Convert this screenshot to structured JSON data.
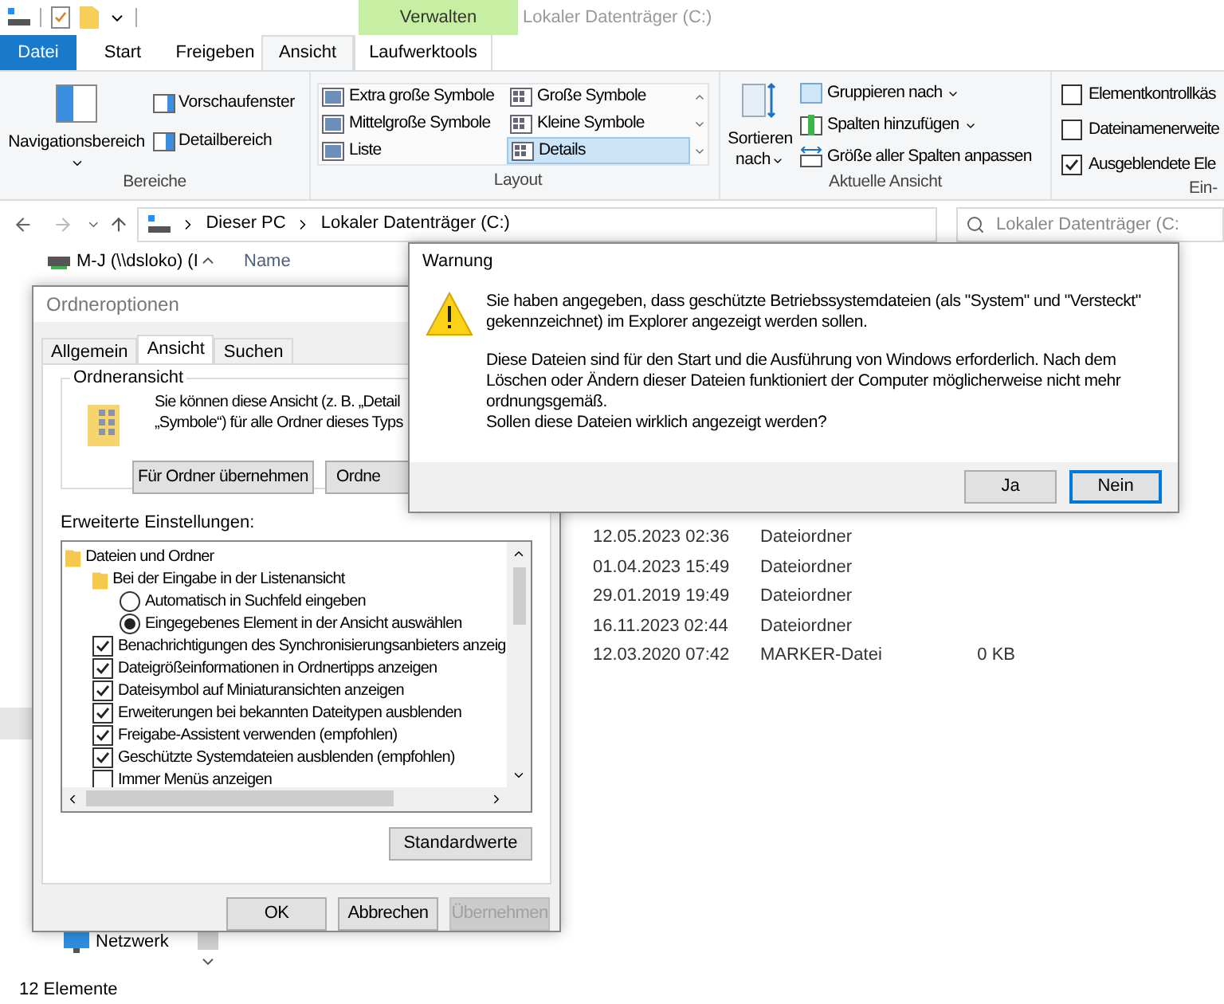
{
  "explorer": {
    "context_group": "Verwalten",
    "title": "Lokaler Datenträger (C:)",
    "tabs": [
      {
        "label": "Datei",
        "kind": "file",
        "selected": false
      },
      {
        "label": "Start",
        "kind": "tab",
        "selected": false
      },
      {
        "label": "Freigeben",
        "kind": "tab",
        "selected": false
      },
      {
        "label": "Ansicht",
        "kind": "tab",
        "selected": true
      },
      {
        "label": "Laufwerktools",
        "kind": "context",
        "selected": false
      }
    ],
    "panes_group": {
      "label": "Bereiche",
      "navigation": "Navigationsbereich",
      "preview": "Vorschaufenster",
      "details": "Detailbereich"
    },
    "layout_group": {
      "label": "Layout",
      "options": [
        {
          "label": "Extra große Symbole",
          "selected": false
        },
        {
          "label": "Große Symbole",
          "selected": false
        },
        {
          "label": "Mittelgroße Symbole",
          "selected": false
        },
        {
          "label": "Kleine Symbole",
          "selected": false
        },
        {
          "label": "Liste",
          "selected": false
        },
        {
          "label": "Details",
          "selected": true
        }
      ]
    },
    "view_group": {
      "label": "Aktuelle Ansicht",
      "sort_lines": [
        "Sortieren",
        "nach"
      ],
      "group_by": "Gruppieren nach",
      "add_columns": "Spalten hinzufügen",
      "fit_columns": "Größe aller Spalten anpassen"
    },
    "show_group": {
      "label": "Ein-",
      "options": [
        {
          "label": "Elementkontrollkäs",
          "checked": false
        },
        {
          "label": "Dateinamenerweite",
          "checked": false
        },
        {
          "label": "Ausgeblendete Ele",
          "checked": true
        }
      ]
    },
    "address": {
      "path": [
        "Dieser PC",
        "Lokaler Datenträger (C:)"
      ]
    },
    "search": {
      "placeholder": "Lokaler Datenträger (C:"
    },
    "nav_pane": {
      "items": [
        {
          "label": "M-J (\\\\dsloko) (I",
          "kind": "drive"
        },
        {
          "label": "Netzwerk",
          "kind": "network"
        }
      ]
    },
    "file_list": {
      "columns": [
        "Name"
      ],
      "rows": [
        {
          "modified": "12.05.2023 02:36",
          "type": "Dateiordner"
        },
        {
          "modified": "01.04.2023 15:49",
          "type": "Dateiordner"
        },
        {
          "modified": "29.01.2019 19:49",
          "type": "Dateiordner"
        },
        {
          "modified": "16.11.2023 02:44",
          "type": "Dateiordner"
        },
        {
          "modified": "12.03.2020 07:42",
          "type": "MARKER-Datei",
          "size": "0 KB"
        }
      ]
    },
    "status_bar": "12 Elemente"
  },
  "folder_options": {
    "title": "Ordneroptionen",
    "tabs": [
      {
        "label": "Allgemein",
        "selected": false
      },
      {
        "label": "Ansicht",
        "selected": true
      },
      {
        "label": "Suchen",
        "selected": false
      }
    ],
    "folder_view": {
      "label": "Ordneransicht",
      "description_lines": [
        "Sie können diese Ansicht (z. B. „Detail",
        "„Symbole“) für alle Ordner dieses Typs"
      ],
      "buttons": [
        "Für Ordner übernehmen",
        "Ordne"
      ]
    },
    "advanced_label": "Erweiterte Einstellungen:",
    "settings": [
      {
        "kind": "folder",
        "label": "Dateien und Ordner",
        "children": [
          {
            "kind": "folder",
            "label": "Bei der Eingabe in der Listenansicht",
            "children": [
              {
                "kind": "radio",
                "label": "Automatisch in Suchfeld eingeben",
                "selected": false
              },
              {
                "kind": "radio",
                "label": "Eingegebenes Element in der Ansicht auswählen",
                "selected": true
              }
            ]
          },
          {
            "kind": "checkbox",
            "label": "Benachrichtigungen des Synchronisierungsanbieters anzeig",
            "checked": true
          },
          {
            "kind": "checkbox",
            "label": "Dateigrößeinformationen in Ordnertipps anzeigen",
            "checked": true
          },
          {
            "kind": "checkbox",
            "label": "Dateisymbol auf Miniaturansichten anzeigen",
            "checked": true
          },
          {
            "kind": "checkbox",
            "label": "Erweiterungen bei bekannten Dateitypen ausblenden",
            "checked": true
          },
          {
            "kind": "checkbox",
            "label": "Freigabe-Assistent verwenden (empfohlen)",
            "checked": true
          },
          {
            "kind": "checkbox",
            "label": "Geschützte Systemdateien ausblenden (empfohlen)",
            "checked": true
          },
          {
            "kind": "checkbox",
            "label": "Immer Menüs anzeigen",
            "checked": false
          }
        ]
      }
    ],
    "defaults_button": "Standardwerte",
    "buttons": [
      {
        "label": "OK",
        "disabled": false
      },
      {
        "label": "Abbrechen",
        "disabled": false
      },
      {
        "label": "Übernehmen",
        "disabled": true
      }
    ]
  },
  "warning": {
    "title": "Warnung",
    "paragraphs": [
      [
        "Sie haben angegeben, dass geschützte Betriebssystemdateien (als \"System\" und \"Versteckt\" gekennzeichnet) im Explorer angezeigt werden sollen."
      ],
      [
        "Diese Dateien sind für den Start und die Ausführung von Windows erforderlich. Nach dem Löschen oder Ändern dieser Dateien funktioniert der Computer möglicherweise nicht mehr ordnungsgemäß.",
        "Sollen diese Dateien wirklich angezeigt werden?"
      ]
    ],
    "buttons": [
      {
        "label": "Ja",
        "default": false
      },
      {
        "label": "Nein",
        "default": true
      }
    ]
  }
}
